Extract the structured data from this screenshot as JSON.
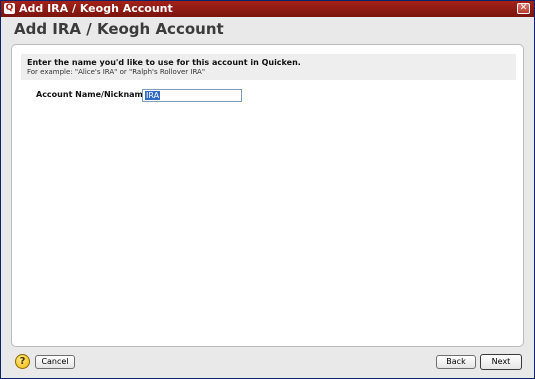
{
  "window": {
    "title": "Add IRA / Keogh Account",
    "app_icon_glyph": "Q",
    "close_glyph": "✕"
  },
  "dialog": {
    "heading": "Add IRA / Keogh Account",
    "instruction": "Enter the name you'd like to use for this account in Quicken.",
    "example": "For example: \"Alice's IRA\" or \"Ralph's Rollover IRA\"",
    "field_label": "Account Name/Nickname",
    "field_value": "IRA"
  },
  "footer": {
    "help_glyph": "?",
    "cancel_label": "Cancel",
    "back_label": "Back",
    "next_label": "Next"
  },
  "colors": {
    "titlebar": "#a32218",
    "selection": "#316ac5",
    "help": "#f0b800"
  }
}
